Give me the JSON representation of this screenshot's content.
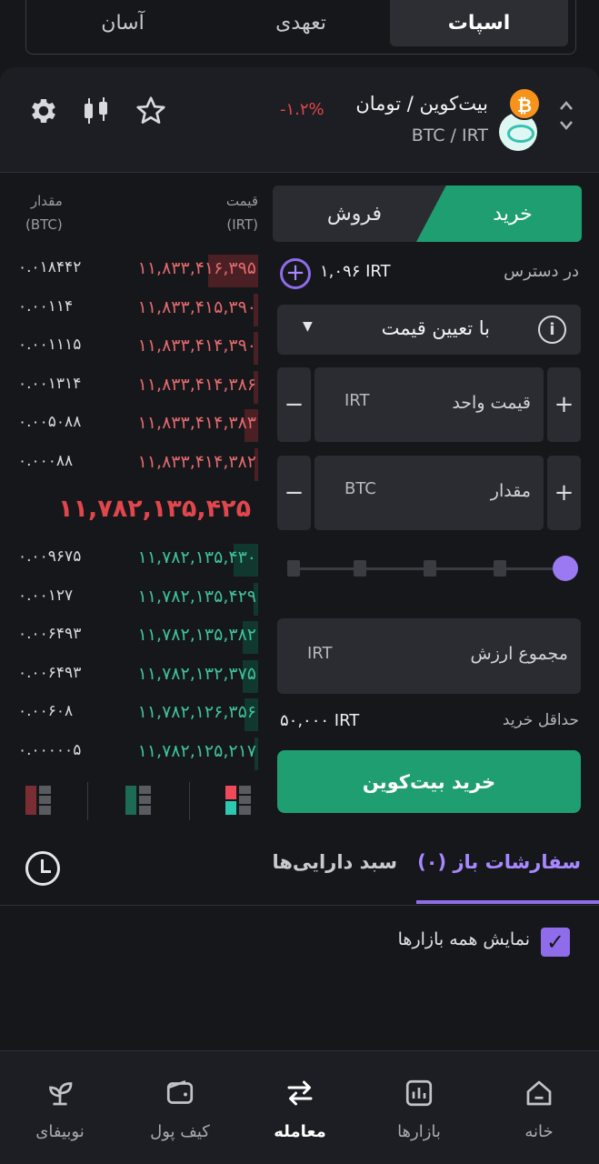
{
  "mode_tabs": [
    {
      "label": "اسپات",
      "active": true
    },
    {
      "label": "تعهدی",
      "active": false
    },
    {
      "label": "آسان",
      "active": false
    }
  ],
  "market": {
    "title": "بیت‌کوین / تومان",
    "symbol": "BTC / IRT",
    "change": "-۱.۲%",
    "base_icon": "bitcoin-icon",
    "quote_icon": "toman-icon",
    "actions": [
      "settings-icon",
      "candlestick-chart-icon",
      "star-icon"
    ]
  },
  "orderbook": {
    "price_header": "قیمت",
    "price_unit": "(IRT)",
    "amount_header": "مقدار",
    "amount_unit": "(BTC)",
    "asks": [
      {
        "price": "۱۱,۸۳۳,۴۱۶,۳۹۵",
        "amount": "۰.۰۱۸۴۴۲",
        "depth": 0.22
      },
      {
        "price": "۱۱,۸۳۳,۴۱۵,۳۹۰",
        "amount": "۰.۰۰۱۱۴",
        "depth": 0.02
      },
      {
        "price": "۱۱,۸۳۳,۴۱۴,۳۹۰",
        "amount": "۰.۰۰۱۱۱۵",
        "depth": 0.02
      },
      {
        "price": "۱۱,۸۳۳,۴۱۴,۳۸۶",
        "amount": "۰.۰۰۱۳۱۴",
        "depth": 0.02
      },
      {
        "price": "۱۱,۸۳۳,۴۱۴,۳۸۳",
        "amount": "۰.۰۰۵۰۸۸",
        "depth": 0.06
      },
      {
        "price": "۱۱,۸۳۳,۴۱۴,۳۸۲",
        "amount": "۰.۰۰۰۸۸",
        "depth": 0.01
      }
    ],
    "last_price": "۱۱,۷۸۲,۱۳۵,۴۲۵",
    "bids": [
      {
        "price": "۱۱,۷۸۲,۱۳۵,۴۳۰",
        "amount": "۰.۰۰۹۶۷۵",
        "depth": 0.11
      },
      {
        "price": "۱۱,۷۸۲,۱۳۵,۴۲۹",
        "amount": "۰.۰۰۱۲۷",
        "depth": 0.02
      },
      {
        "price": "۱۱,۷۸۲,۱۳۵,۳۸۲",
        "amount": "۰.۰۰۶۴۹۳",
        "depth": 0.07
      },
      {
        "price": "۱۱,۷۸۲,۱۳۲,۳۷۵",
        "amount": "۰.۰۰۶۴۹۳",
        "depth": 0.07
      },
      {
        "price": "۱۱,۷۸۲,۱۲۶,۳۵۶",
        "amount": "۰.۰۰۶۰۸",
        "depth": 0.06
      },
      {
        "price": "۱۱,۷۸۲,۱۲۵,۲۱۷",
        "amount": "۰.۰۰۰۰۰۵",
        "depth": 0.005
      }
    ],
    "view_modes": [
      "view-both-icon",
      "view-bids-icon",
      "view-asks-icon"
    ]
  },
  "trade": {
    "buy_label": "خرید",
    "sell_label": "فروش",
    "available_label": "در دسترس",
    "available_value": "۱,۰۹۶ IRT",
    "order_type": "با تعیین قیمت",
    "price_label": "قیمت واحد",
    "price_unit": "IRT",
    "amount_label": "مقدار",
    "amount_unit": "BTC",
    "total_label": "مجموع ارزش",
    "total_unit": "IRT",
    "slider_percent": 100,
    "min_label": "حداقل خرید",
    "min_value": "۵۰,۰۰۰ IRT",
    "submit_label": "خرید بیت‌کوین"
  },
  "orders_tabs": {
    "open_orders": "سفارشات باز (۰)",
    "portfolio": "سبد دارایی‌ها"
  },
  "show_all_markets": {
    "label": "نمایش همه بازارها",
    "checked": true
  },
  "nav": [
    {
      "label": "خانه",
      "icon": "home-icon",
      "active": false
    },
    {
      "label": "بازارها",
      "icon": "markets-chart-icon",
      "active": false
    },
    {
      "label": "معامله",
      "icon": "trade-swap-icon",
      "active": true
    },
    {
      "label": "کیف پول",
      "icon": "wallet-icon",
      "active": false
    },
    {
      "label": "نوبیفای",
      "icon": "sprout-icon",
      "active": false
    }
  ],
  "colors": {
    "buy": "#1f9e72",
    "sell": "#e0474c",
    "accent": "#8f6ce9"
  }
}
